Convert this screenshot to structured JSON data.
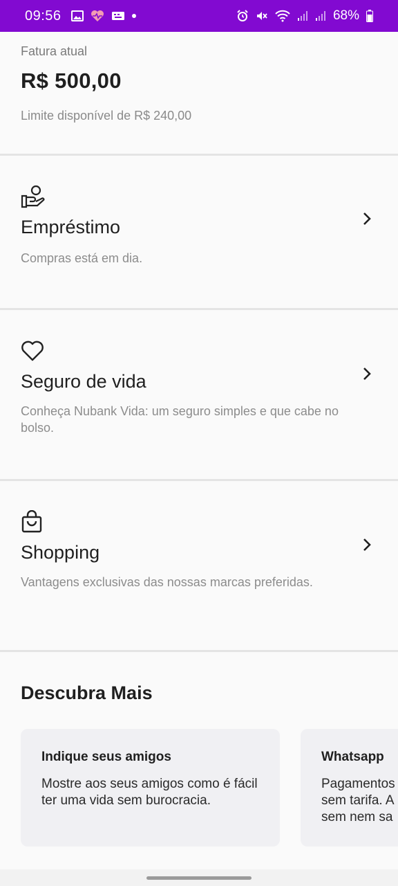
{
  "status_bar": {
    "time": "09:56",
    "battery": "68%",
    "bg_color": "#820ad1"
  },
  "invoice": {
    "label": "Fatura atual",
    "amount": "R$ 500,00",
    "limit": "Limite disponível de R$ 240,00"
  },
  "sections": [
    {
      "icon": "hand-user-icon",
      "title": "Empréstimo",
      "description": "Compras está em dia."
    },
    {
      "icon": "heart-icon",
      "title": "Seguro de vida",
      "description": "Conheça Nubank Vida: um seguro simples e que cabe no bolso."
    },
    {
      "icon": "shopping-bag-icon",
      "title": "Shopping",
      "description": "Vantagens exclusivas das nossas marcas preferidas."
    }
  ],
  "discover": {
    "title": "Descubra Mais",
    "cards": [
      {
        "title": "Indique seus amigos",
        "body": "Mostre aos seus amigos como é fácil ter uma vida sem burocracia."
      },
      {
        "title": "Whatsapp",
        "body": "Pagamentos sem tarifa. A sem nem sa"
      }
    ]
  }
}
